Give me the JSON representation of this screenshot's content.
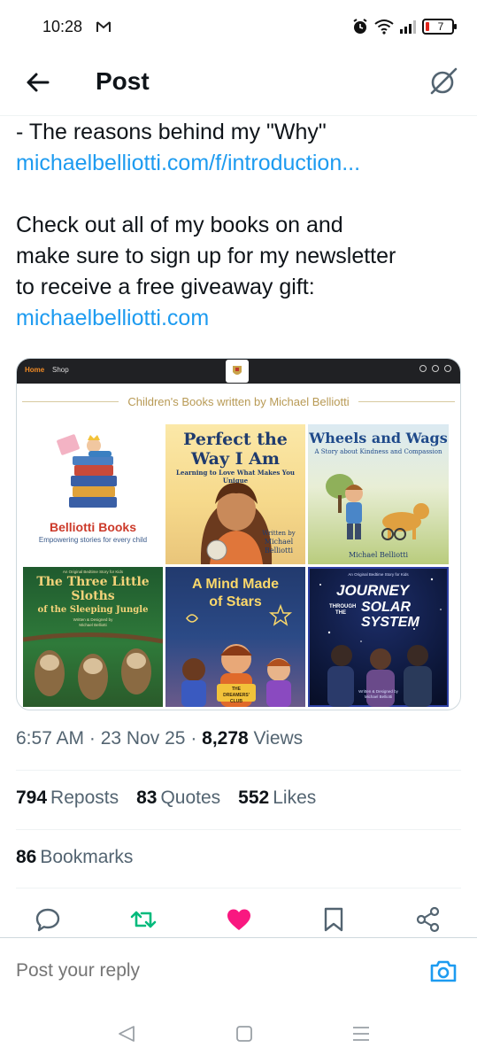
{
  "status_bar": {
    "time": "10:28",
    "mail_icon": "gmail-icon",
    "battery_level": "7"
  },
  "header": {
    "title": "Post"
  },
  "post": {
    "lines": [
      "- The reasons behind my \"Why\"",
      "michaelbelliotti.com/f/introduction...",
      "Check out all of my books on and",
      "make sure to sign up for my newsletter",
      "to receive a free giveaway gift:",
      "michaelbelliotti.com"
    ],
    "link_color": "#1d9bf0"
  },
  "media": {
    "nav_home": "Home",
    "nav_shop": "Shop",
    "heading": "Children's Books written by Michael Belliotti",
    "books": {
      "brand": {
        "name": "Belliotti Books",
        "tagline": "Empowering stories for every child"
      },
      "perfect": {
        "title": "Perfect the Way I Am",
        "subtitle": "Learning to Love What Makes You Unique",
        "written_by": "Written by",
        "author_first": "Michael",
        "author_last": "Belliotti"
      },
      "wheels": {
        "title": "Wheels and Wags",
        "subtitle": "A Story about Kindness and Compassion",
        "author": "Michael Belliotti"
      },
      "sloths": {
        "kicker": "An Original Bedtime Story for Kids",
        "title": "The Three Little Sloths",
        "subtitle": "of the Sleeping Jungle",
        "credit_1": "Written & Designed by",
        "credit_2": "Michael Belliotti"
      },
      "mind": {
        "title_1": "A Mind Made",
        "title_2": "of Stars",
        "badge_1": "THE",
        "badge_2": "DREAMERS'",
        "badge_3": "CLUB"
      },
      "journey": {
        "kicker": "An Original Bedtime Story for Kids",
        "title_1": "JOURNEY",
        "title_2": "THROUGH THE",
        "title_3": "SOLAR",
        "title_4": "SYSTEM",
        "credit_1": "Written & Designed by",
        "credit_2": "Michael Belliotti"
      }
    }
  },
  "meta": {
    "time": "6:57 AM",
    "date": "23 Nov 25",
    "views_count": "8,278",
    "views_label": "Views"
  },
  "stats": {
    "reposts_count": "794",
    "reposts_label": "Reposts",
    "quotes_count": "83",
    "quotes_label": "Quotes",
    "likes_count": "552",
    "likes_label": "Likes",
    "bookmarks_count": "86",
    "bookmarks_label": "Bookmarks"
  },
  "actions": {
    "repost_color": "#00ba7c",
    "like_color": "#f91880"
  },
  "reply": {
    "placeholder": "Post your reply"
  }
}
